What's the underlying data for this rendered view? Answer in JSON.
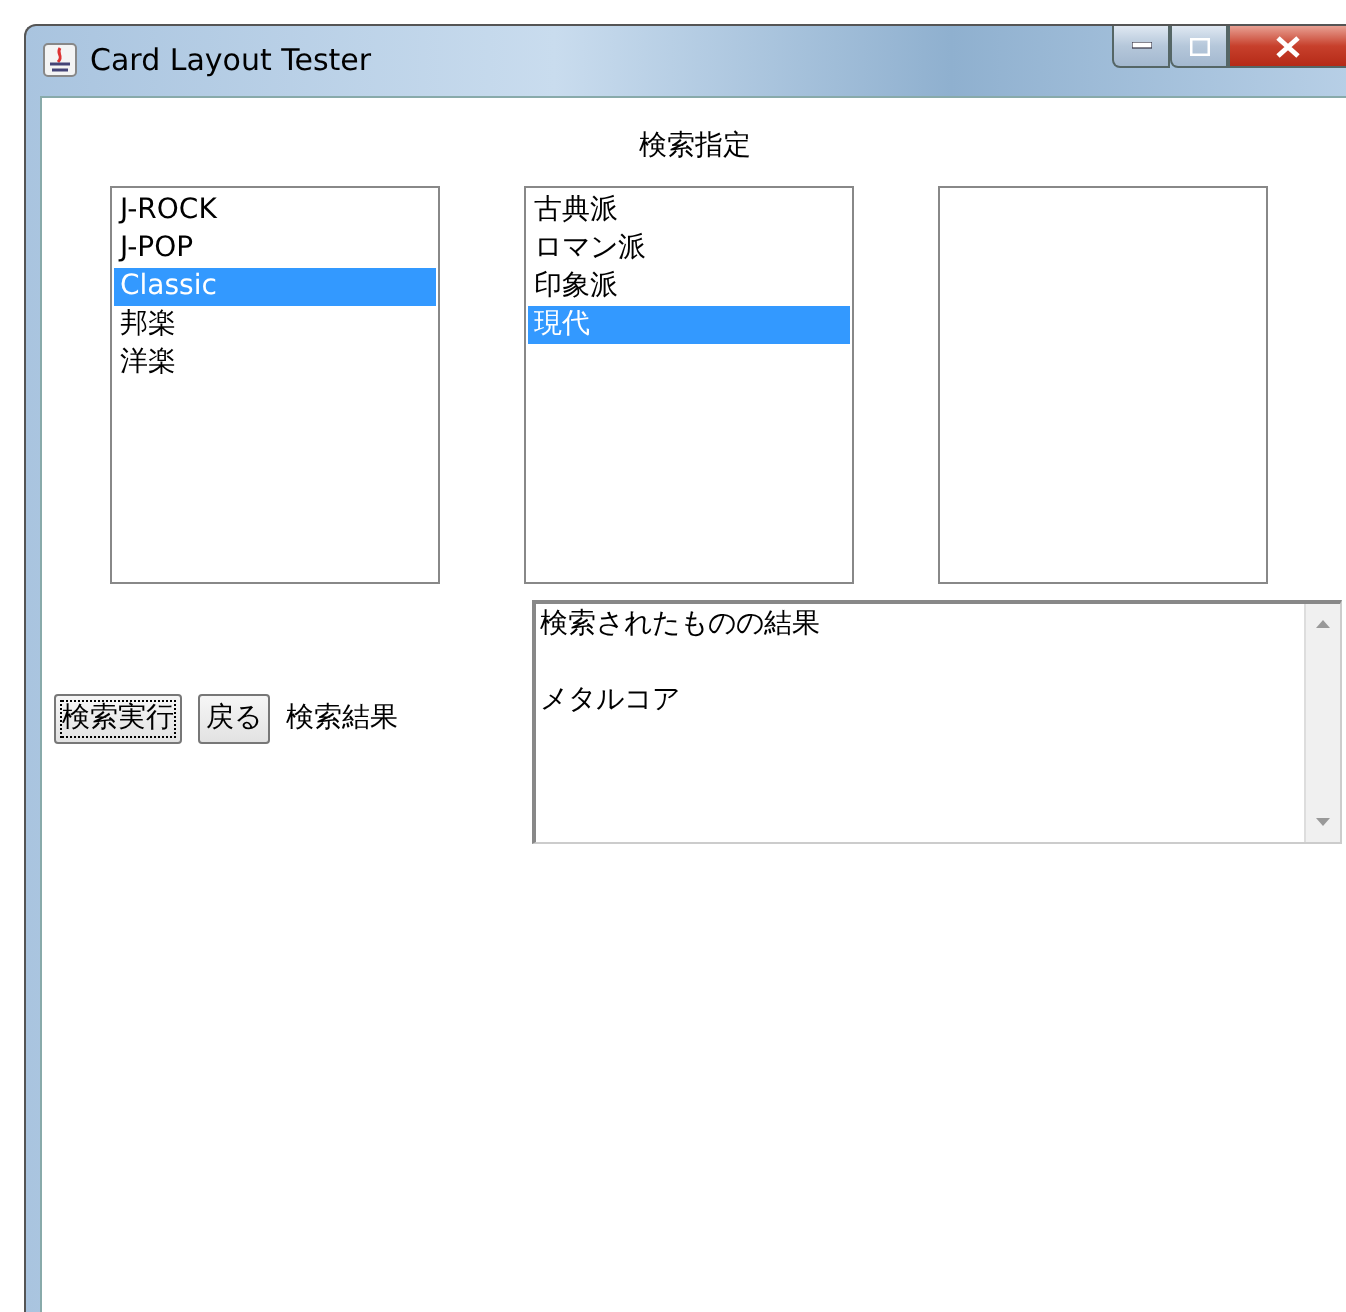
{
  "window": {
    "title": "Card Layout Tester"
  },
  "heading": "検索指定",
  "lists": [
    {
      "kind": "listbox",
      "items": [
        {
          "label": "J-ROCK",
          "selected": false
        },
        {
          "label": "J-POP",
          "selected": false
        },
        {
          "label": "Classic",
          "selected": true
        },
        {
          "label": "邦楽",
          "selected": false
        },
        {
          "label": "洋楽",
          "selected": false
        }
      ]
    },
    {
      "kind": "listbox",
      "items": [
        {
          "label": "古典派",
          "selected": false
        },
        {
          "label": "ロマン派",
          "selected": false
        },
        {
          "label": "印象派",
          "selected": false
        },
        {
          "label": "現代",
          "selected": true
        }
      ]
    },
    {
      "kind": "listbox"
    }
  ],
  "buttons": [
    {
      "label": "検索実行",
      "focused": true
    },
    {
      "label": "戻る",
      "focused": false
    }
  ],
  "result_label": "検索結果",
  "result_text": [
    "検索されたものの結果",
    "メタルコア"
  ]
}
